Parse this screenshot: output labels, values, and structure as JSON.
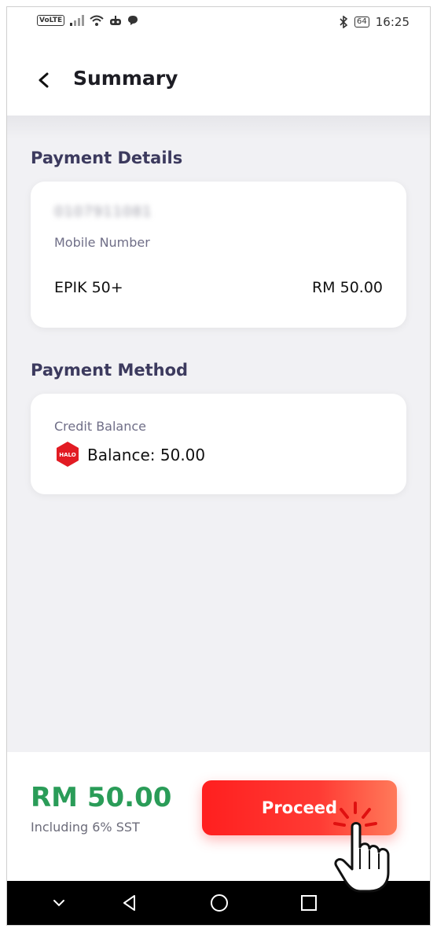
{
  "status_bar": {
    "network_badge": "VoLTE",
    "battery": "64",
    "time": "16:25",
    "icons": [
      "signal-icon",
      "wifi-icon",
      "notification-icon",
      "chat-icon",
      "bluetooth-icon",
      "battery-icon"
    ]
  },
  "header": {
    "title": "Summary",
    "back_icon": "chevron-left-icon"
  },
  "payment_details": {
    "section_title": "Payment Details",
    "mobile_number": "0107911081",
    "mobile_label": "Mobile Number",
    "plan_name": "EPIK 50+",
    "plan_price": "RM 50.00"
  },
  "payment_method": {
    "section_title": "Payment Method",
    "method_label": "Credit Balance",
    "logo_text": "HALO",
    "balance_label": "Balance:",
    "balance_value": "50.00"
  },
  "footer": {
    "total": "RM 50.00",
    "tax_note": "Including 6% SST",
    "proceed_label": "Proceed"
  },
  "colors": {
    "accent_red": "#ff2a2a",
    "total_green": "#2a9c58",
    "section_title": "#3c3a5e"
  },
  "nav_bar": {
    "icons": [
      "chevron-down-icon",
      "back-triangle-icon",
      "home-circle-icon",
      "recents-square-icon"
    ]
  }
}
